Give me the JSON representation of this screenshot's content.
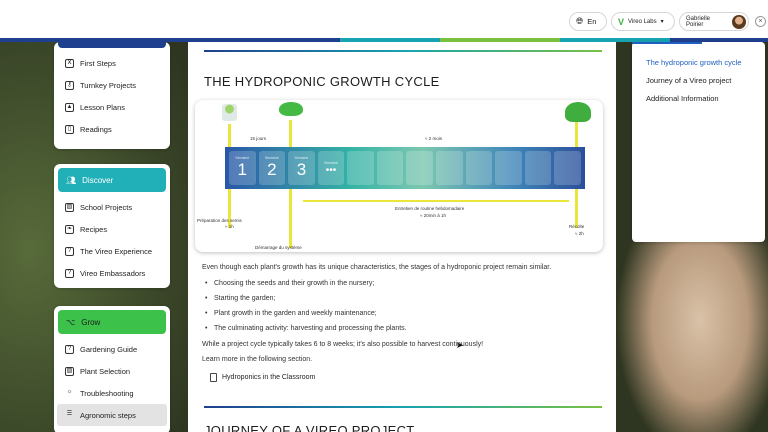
{
  "header": {
    "language_label": "En",
    "workspace_label": "Vireo Labs",
    "user_name": "Gabrielle Poirier",
    "accent_colors": [
      "#1f3f8f",
      "#1f3f8f",
      "#17a3b0",
      "#7ac142",
      "#17a3b0",
      "#1f3f8f"
    ]
  },
  "sidebar": {
    "section_top": {
      "items": [
        {
          "label": "First Steps",
          "icon": "sprout-icon"
        },
        {
          "label": "Turnkey Projects",
          "icon": "key-icon"
        },
        {
          "label": "Lesson Plans",
          "icon": "graduation-cap-icon"
        },
        {
          "label": "Readings",
          "icon": "book-icon"
        }
      ]
    },
    "section_discover": {
      "title": "Discover",
      "color": "#22b0b8",
      "items": [
        {
          "label": "School Projects",
          "icon": "image-icon"
        },
        {
          "label": "Recipes",
          "icon": "leaf-icon"
        },
        {
          "label": "The Vireo Experience",
          "icon": "question-icon"
        },
        {
          "label": "Vireo Embassadors",
          "icon": "question-icon"
        }
      ]
    },
    "section_grow": {
      "title": "Grow",
      "color": "#3cc14a",
      "items": [
        {
          "label": "Gardening Guide",
          "icon": "question-icon"
        },
        {
          "label": "Plant Selection",
          "icon": "image-icon"
        },
        {
          "label": "Troubleshooting",
          "icon": "bulb-icon"
        },
        {
          "label": "Agronomic steps",
          "icon": "list-icon",
          "active": true
        }
      ]
    }
  },
  "article": {
    "title": "THE HYDROPONIC GROWTH CYCLE",
    "diagram": {
      "labels": {
        "weeks": "15 jours",
        "months": "≈ 2 mois",
        "maintenance": "Entretien de routine hebdomadaire",
        "maintenance_time": "≈ 20min à 1h",
        "seeding": "Préparation des semis",
        "seeding_time": "≈ 1h",
        "harvest": "Récolte",
        "harvest_time": "≈ 2h",
        "transplant": "Démarrage du système"
      },
      "steps": [
        {
          "caption": "Semaine",
          "number": "1"
        },
        {
          "caption": "Semaine",
          "number": "2"
        },
        {
          "caption": "Semaine",
          "number": "3"
        },
        {
          "caption": "Semaine",
          "number": "•••"
        }
      ]
    },
    "intro": "Even though each plant's growth has its unique characteristics, the stages of a hydroponic project remain similar.",
    "bullets": [
      "Choosing the seeds and their growth in the nursery;",
      "Starting the garden;",
      "Plant growth in the garden and weekly maintenance;",
      "The culminating activity: harvesting and processing the plants."
    ],
    "cycle_note": "While a project cycle typically takes 6 to 8 weeks; it's also possible to harvest continuously!",
    "learn_more": "Learn more in the following section.",
    "link_label": "Hydroponics in the Classroom",
    "next_title": "JOURNEY OF A VIREO PROJECT"
  },
  "toc": {
    "items": [
      {
        "label": "The hydroponic growth cycle",
        "active": true
      },
      {
        "label": "Journey of a Vireo project"
      },
      {
        "label": "Additional Information"
      }
    ],
    "active_color": "#1f5fbf"
  }
}
